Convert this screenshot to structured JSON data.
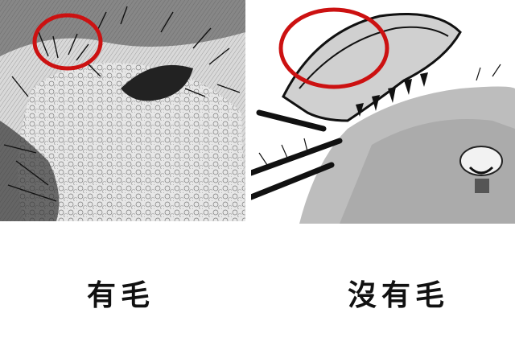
{
  "captions": {
    "left": "有毛",
    "right": "沒有毛"
  },
  "colors": {
    "highlight_circle": "#cc1111",
    "sketch_dark": "#1a1a1a",
    "background": "#ffffff"
  }
}
